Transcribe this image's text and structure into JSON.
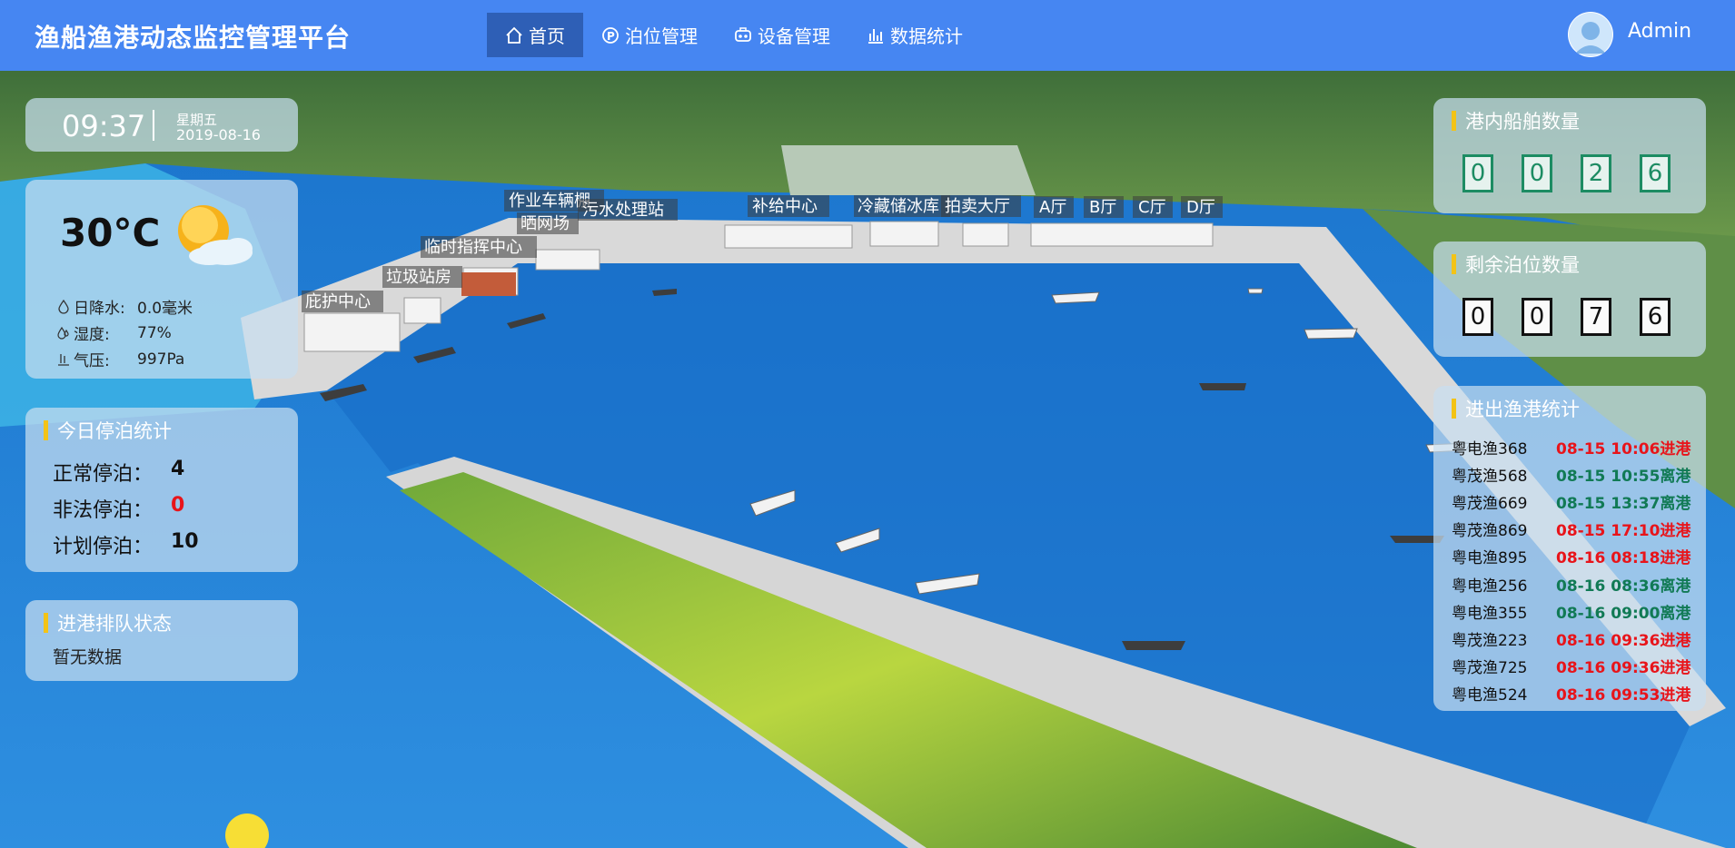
{
  "header": {
    "title": "渔船渔港动态监控管理平台",
    "nav": [
      {
        "label": "首页",
        "icon": "home-icon",
        "active": true
      },
      {
        "label": "泊位管理",
        "icon": "parking-icon"
      },
      {
        "label": "设备管理",
        "icon": "device-icon"
      },
      {
        "label": "数据统计",
        "icon": "bar-chart-icon"
      }
    ],
    "user": "Admin"
  },
  "datetime": {
    "time": "09:37",
    "weekday": "星期五",
    "date": "2019-08-16"
  },
  "weather": {
    "temperature": "30°C",
    "icon": "sun-cloud-icon",
    "rows": [
      {
        "icon": "raindrop-icon",
        "label": "日降水:",
        "value": "0.0毫米"
      },
      {
        "icon": "humidity-icon",
        "label": "湿度:",
        "value": "77%"
      },
      {
        "icon": "pressure-icon",
        "label": "气压:",
        "value": "997Pa"
      }
    ]
  },
  "today_berthing": {
    "title": "今日停泊统计",
    "rows": [
      {
        "label": "正常停泊：",
        "value": "4",
        "color": "#111111"
      },
      {
        "label": "非法停泊：",
        "value": "0",
        "color": "#e8141a"
      },
      {
        "label": "计划停泊：",
        "value": "10",
        "color": "#111111"
      }
    ]
  },
  "queue": {
    "title": "进港排队状态",
    "empty_text": "暂无数据"
  },
  "ships_in_port": {
    "title": "港内船舶数量",
    "digits": [
      "0",
      "0",
      "2",
      "6"
    ]
  },
  "remaining_berths": {
    "title": "剩余泊位数量",
    "digits": [
      "0",
      "0",
      "7",
      "6"
    ]
  },
  "port_traffic": {
    "title": "进出渔港统计",
    "rows": [
      {
        "ship": "粤电渔368",
        "info": "08-15 10:06进港",
        "type": "in"
      },
      {
        "ship": "粤茂渔568",
        "info": "08-15 10:55离港",
        "type": "out"
      },
      {
        "ship": "粤茂渔669",
        "info": "08-15 13:37离港",
        "type": "out"
      },
      {
        "ship": "粤茂渔869",
        "info": "08-15 17:10进港",
        "type": "in"
      },
      {
        "ship": "粤电渔895",
        "info": "08-16 08:18进港",
        "type": "in"
      },
      {
        "ship": "粤电渔256",
        "info": "08-16 08:36离港",
        "type": "out"
      },
      {
        "ship": "粤电渔355",
        "info": "08-16 09:00离港",
        "type": "out"
      },
      {
        "ship": "粤茂渔223",
        "info": "08-16 09:36进港",
        "type": "in"
      },
      {
        "ship": "粤茂渔725",
        "info": "08-16 09:36进港",
        "type": "in"
      },
      {
        "ship": "粤电渔524",
        "info": "08-16 09:53进港",
        "type": "in"
      }
    ],
    "colors": {
      "in": "#e8141a",
      "out": "#117a55"
    }
  },
  "map_labels": [
    "作业车辆棚",
    "污水处理站",
    "晒网场",
    "临时指挥中心",
    "垃圾站房",
    "庇护中心",
    "补给中心",
    "冷藏储冰库",
    "拍卖大厅",
    "A厅",
    "B厅",
    "C厅",
    "D厅"
  ]
}
